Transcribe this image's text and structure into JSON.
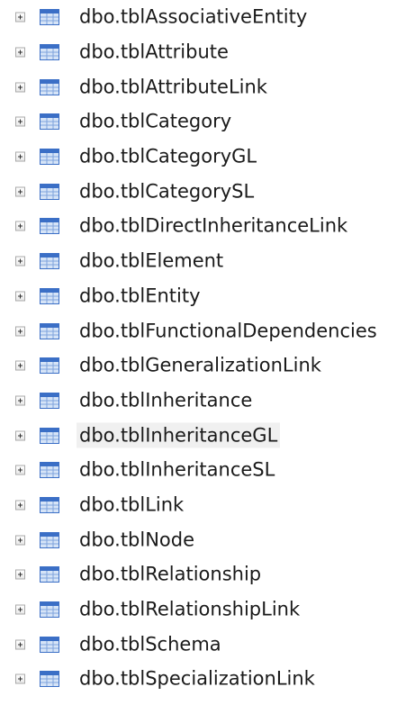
{
  "tree": {
    "items": [
      {
        "label": "dbo.tblAssociativeEntity",
        "selected": false
      },
      {
        "label": "dbo.tblAttribute",
        "selected": false
      },
      {
        "label": "dbo.tblAttributeLink",
        "selected": false
      },
      {
        "label": "dbo.tblCategory",
        "selected": false
      },
      {
        "label": "dbo.tblCategoryGL",
        "selected": false
      },
      {
        "label": "dbo.tblCategorySL",
        "selected": false
      },
      {
        "label": "dbo.tblDirectInheritanceLink",
        "selected": false
      },
      {
        "label": "dbo.tblElement",
        "selected": false
      },
      {
        "label": "dbo.tblEntity",
        "selected": false
      },
      {
        "label": "dbo.tblFunctionalDependencies",
        "selected": false
      },
      {
        "label": "dbo.tblGeneralizationLink",
        "selected": false
      },
      {
        "label": "dbo.tblInheritance",
        "selected": false
      },
      {
        "label": "dbo.tblInheritanceGL",
        "selected": true
      },
      {
        "label": "dbo.tblInheritanceSL",
        "selected": false
      },
      {
        "label": "dbo.tblLink",
        "selected": false
      },
      {
        "label": "dbo.tblNode",
        "selected": false
      },
      {
        "label": "dbo.tblRelationship",
        "selected": false
      },
      {
        "label": "dbo.tblRelationshipLink",
        "selected": false
      },
      {
        "label": "dbo.tblSchema",
        "selected": false
      },
      {
        "label": "dbo.tblSpecializationLink",
        "selected": false
      }
    ]
  },
  "icons": {
    "expander": "expand-plus-icon",
    "table": "table-icon"
  },
  "colors": {
    "text": "#1a1a1a",
    "selected_background": "#f0f0f0",
    "table_icon_header": "#3b6fc6",
    "table_icon_cells": "#d6e4f7"
  }
}
